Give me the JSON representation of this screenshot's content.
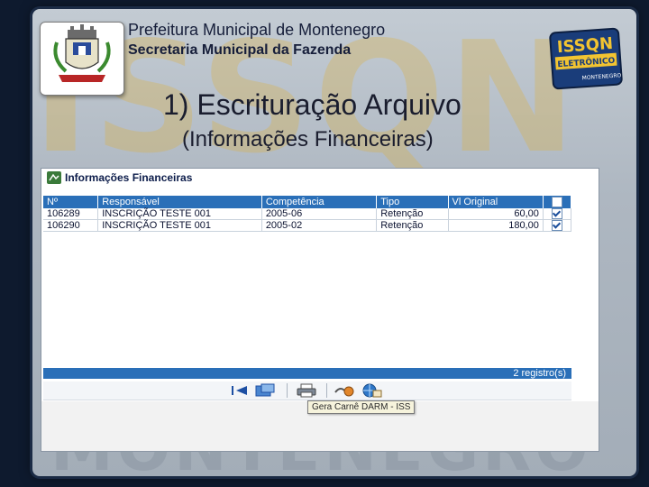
{
  "header": {
    "title": "Prefeitura Municipal de Montenegro",
    "subtitle": "Secretaria Municipal da Fazenda",
    "logo_text_top": "ISSQN",
    "logo_text_mid": "ELETRÔNICO",
    "logo_text_bottom": "MONTENEGRO"
  },
  "slide": {
    "title": "1) Escrituração Arquivo",
    "subtitle": "(Informações Financeiras)"
  },
  "window": {
    "title": "Informações Financeiras",
    "columns": [
      "Nº",
      "Responsável",
      "Competência",
      "Tipo",
      "Vl Original"
    ],
    "rows": [
      {
        "numero": "106289",
        "responsavel": "INSCRIÇÃO TESTE 001",
        "competencia": "2005-06",
        "tipo": "Retenção",
        "valor": "60,00",
        "checked": true
      },
      {
        "numero": "106290",
        "responsavel": "INSCRIÇÃO TESTE 001",
        "competencia": "2005-02",
        "tipo": "Retenção",
        "valor": "180,00",
        "checked": true
      }
    ],
    "status": "2 registro(s)",
    "tooltip": "Gera Carnê DARM - ISS"
  },
  "colors": {
    "grid_header": "#2a6fb8",
    "slide_bg": "#aeb7c1",
    "accent_gold": "#d9b24a"
  }
}
